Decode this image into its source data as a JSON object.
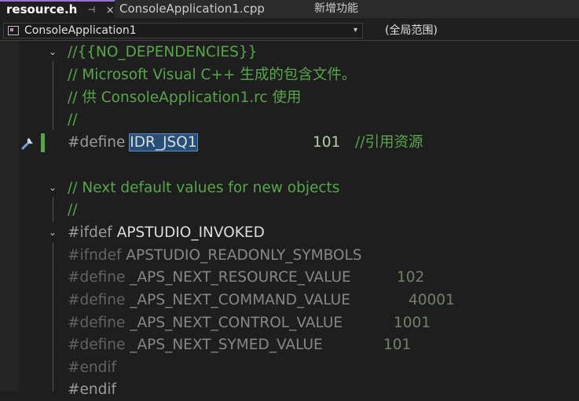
{
  "tabs": [
    {
      "label": "resource.h",
      "active": true,
      "pin": "⊣",
      "close": "×"
    },
    {
      "label": "ConsoleApplication1.cpp",
      "active": false
    },
    {
      "label": "新增功能",
      "active": false
    }
  ],
  "navbar": {
    "project": "ConsoleApplication1",
    "scope": "(全局范围)",
    "dropdown": "▾"
  },
  "fold_glyph": "⌄",
  "code": {
    "l1": "//{{NO_DEPENDENCIES}}",
    "l2": "// Microsoft Visual C++ 生成的包含文件。",
    "l3": "// 供 ConsoleApplication1.rc 使用",
    "l4": "//",
    "l5_kw": "#define ",
    "l5_id": "IDR_JSQ1",
    "l5_num": "101",
    "l5_cm": "//引用资源",
    "l7": "// Next default values for new objects",
    "l8": "//",
    "l9_kw": "#ifdef ",
    "l9_id": "APSTUDIO_INVOKED",
    "l10_kw": "#ifndef ",
    "l10_id": "APSTUDIO_READONLY_SYMBOLS",
    "l11_kw": "#define ",
    "l11_id": "_APS_NEXT_RESOURCE_VALUE",
    "l11_num": "102",
    "l12_kw": "#define ",
    "l12_id": "_APS_NEXT_COMMAND_VALUE",
    "l12_num": "40001",
    "l13_kw": "#define ",
    "l13_id": "_APS_NEXT_CONTROL_VALUE",
    "l13_num": "1001",
    "l14_kw": "#define ",
    "l14_id": "_APS_NEXT_SYMED_VALUE",
    "l14_num": "101",
    "l15": "#endif",
    "l16": "#endif"
  },
  "colors": {
    "comment": "#57a64a",
    "preprocessor": "#9b9b9b",
    "identifier": "#dcdcdc",
    "number": "#b5cea8",
    "selection": "#264f78",
    "change_bar": "#57a64a",
    "active_tab_accent": "#9b6fcf"
  }
}
